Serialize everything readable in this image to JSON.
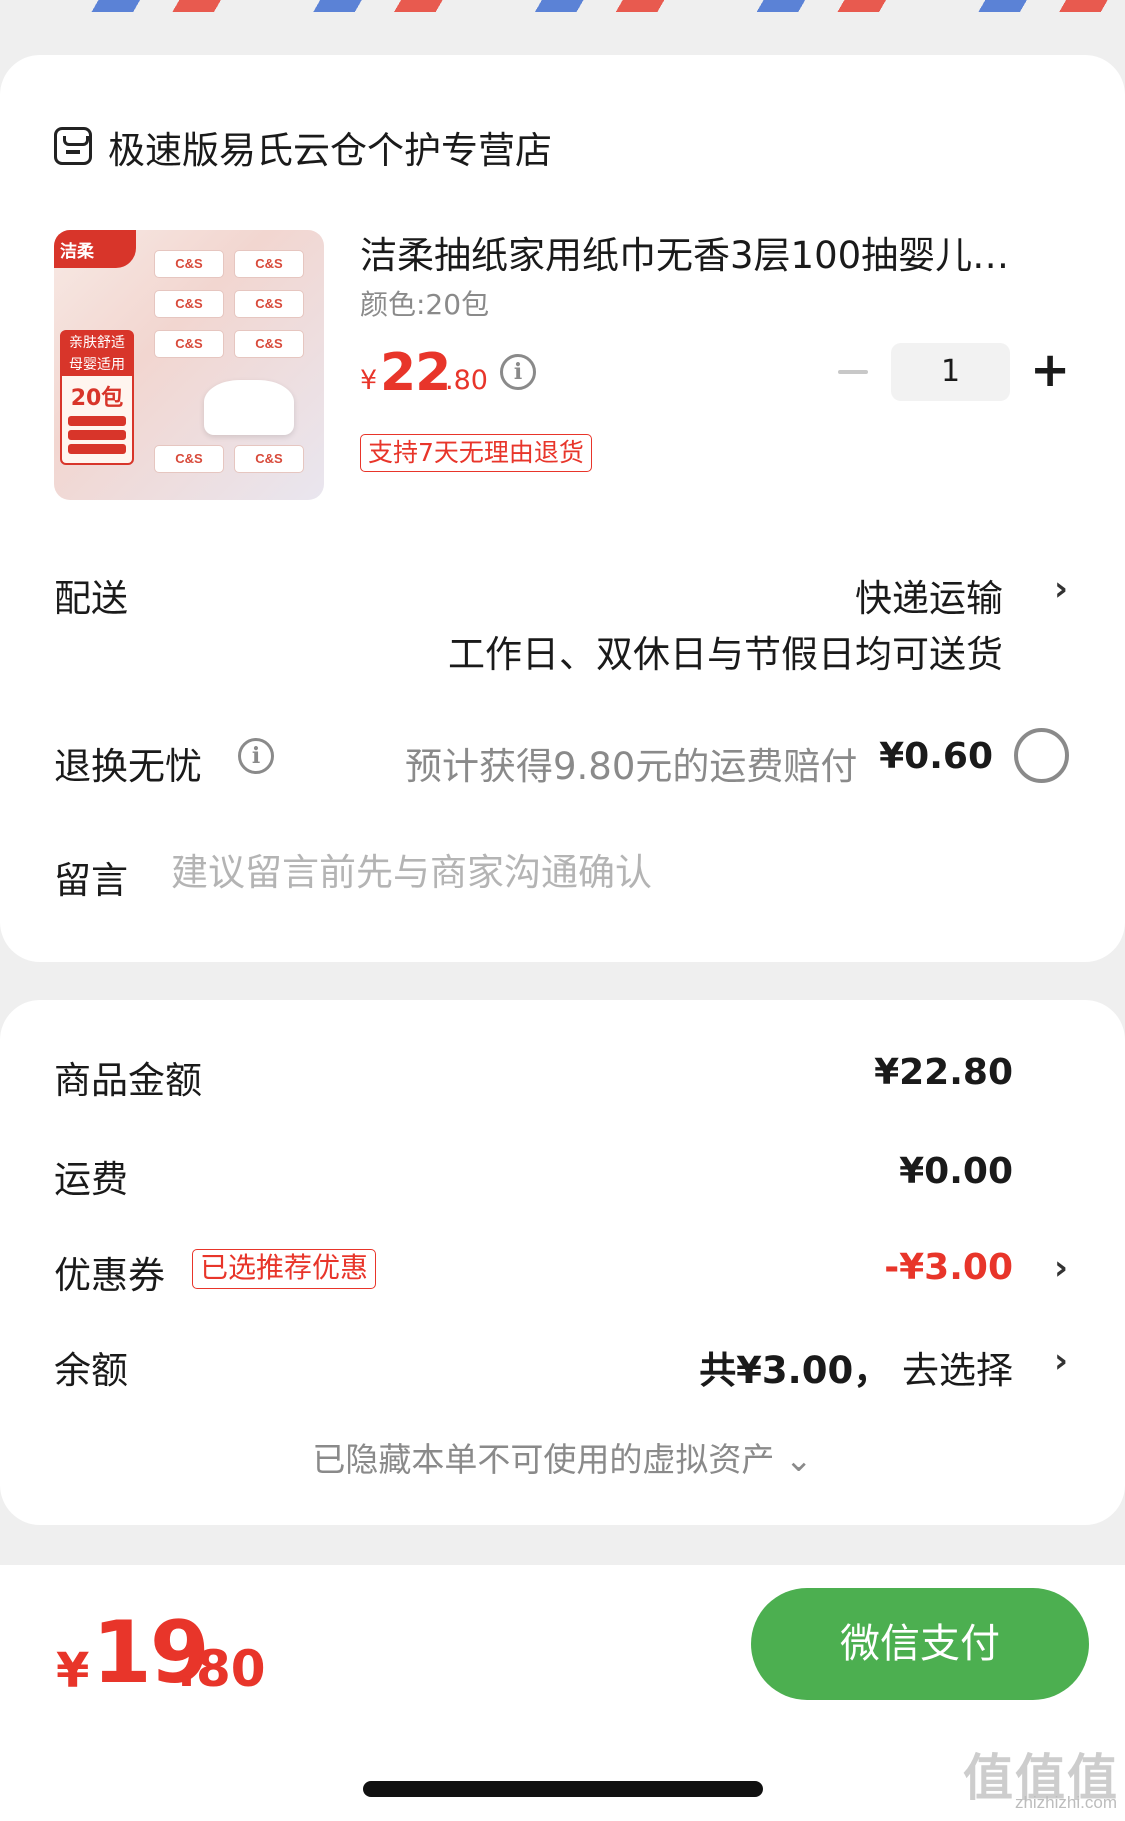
{
  "store": {
    "name": "极速版易氏云仓个护专营店",
    "icon": "store-icon"
  },
  "product": {
    "title": "洁柔抽纸家用纸巾无香3层100抽婴儿…",
    "spec": "颜色:20包",
    "price_symbol": "¥",
    "price_int": "22",
    "price_dec": ".80",
    "quantity": "1",
    "minus_label": "−",
    "plus_label": "+",
    "return_policy": "支持7天无理由退货",
    "image": {
      "brand": "洁柔",
      "pack_text": "C&S",
      "badge_line1": "亲肤舒适",
      "badge_line2": "母婴适用",
      "badge_count": "20包"
    }
  },
  "delivery": {
    "label": "配送",
    "method": "快递运输",
    "note": "工作日、双休日与节假日均可送货"
  },
  "worry_free": {
    "label": "退换无忧",
    "description": "预计获得9.80元的运费赔付",
    "price": "¥0.60"
  },
  "message": {
    "label": "留言",
    "placeholder": "建议留言前先与商家沟通确认"
  },
  "costs": {
    "goods_label": "商品金额",
    "goods_value": "¥22.80",
    "shipping_label": "运费",
    "shipping_value": "¥0.00",
    "coupon_label": "优惠券",
    "coupon_tag": "已选推荐优惠",
    "coupon_value": "-¥3.00",
    "balance_label": "余额",
    "balance_amount": "共¥3.00，",
    "balance_action": "去选择",
    "hidden_note": "已隐藏本单不可使用的虚拟资产 ⌄"
  },
  "footer": {
    "total_symbol": "¥",
    "total_int": "19",
    "total_dec": ".80",
    "pay_button": "微信支付"
  },
  "watermark": {
    "main": "值值值",
    "sub": "zhizhizhi.com"
  },
  "icons": {
    "chevron": "›",
    "info": "i"
  },
  "colors": {
    "accent": "#e8352a",
    "pay": "#4caf50",
    "muted": "#8a8a8a"
  }
}
